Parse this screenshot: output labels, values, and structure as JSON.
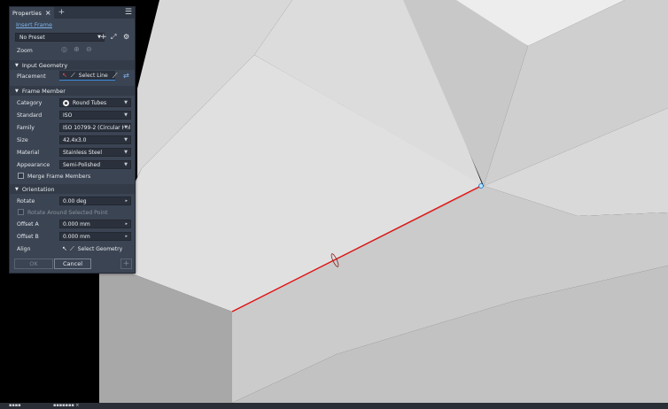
{
  "panel": {
    "tab_title": "Properties",
    "insert_frame_link": "Insert Frame",
    "preset": {
      "value": "No Preset"
    },
    "zoom_label": "Zoom",
    "sections": {
      "input_geometry": "Input Geometry",
      "frame_member": "Frame Member",
      "orientation": "Orientation"
    },
    "placement": {
      "label": "Placement",
      "button": "Select Line"
    },
    "fields": {
      "category": {
        "label": "Category",
        "value": "Round Tubes"
      },
      "standard": {
        "label": "Standard",
        "value": "ISO"
      },
      "family": {
        "label": "Family",
        "value": "ISO 10799-2 (Circular Hol"
      },
      "size": {
        "label": "Size",
        "value": "42.4x3.0"
      },
      "material": {
        "label": "Material",
        "value": "Stainless Steel"
      },
      "appearance": {
        "label": "Appearance",
        "value": "Semi-Polished"
      }
    },
    "merge_label": "Merge Frame Members",
    "rotate": {
      "label": "Rotate",
      "value": "0.00 deg"
    },
    "rotate_around_label": "Rotate Around Selected Point",
    "offset_a": {
      "label": "Offset A",
      "value": "0.000 mm"
    },
    "offset_b": {
      "label": "Offset B",
      "value": "0.000 mm"
    },
    "align": {
      "label": "Align",
      "button": "Select Geometry"
    },
    "ok_label": "OK",
    "cancel_label": "Cancel"
  },
  "colors": {
    "panel_bg": "#3b4453",
    "accent_blue": "#3a8de0",
    "selected_edge": "#e01010",
    "viewport_bg": "#000000"
  }
}
